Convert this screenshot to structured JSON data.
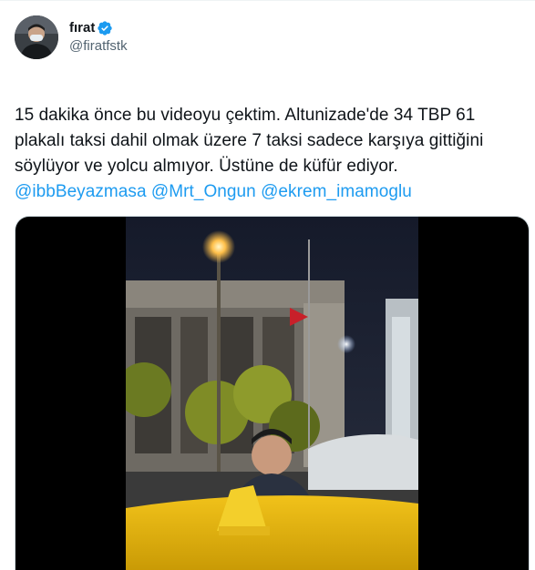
{
  "author": {
    "display_name": "fırat",
    "handle": "@firatfstk",
    "verified": true,
    "verified_color": "#1d9bf0"
  },
  "tweet": {
    "text": "15 dakika önce bu videoyu çektim. Altunizade'de 34 TBP 61 plakalı taksi dahil olmak üzere 7 taksi sadece karşıya gittiğini söylüyor ve yolcu almıyor. Üstüne de küfür ediyor.",
    "mentions": [
      "@ibbBeyazmasa",
      "@Mrt_Ongun",
      "@ekrem_imamoglu"
    ]
  },
  "media": {
    "type": "video"
  },
  "colors": {
    "link": "#1d9bf0",
    "text": "#0f1419",
    "secondary": "#536471"
  }
}
